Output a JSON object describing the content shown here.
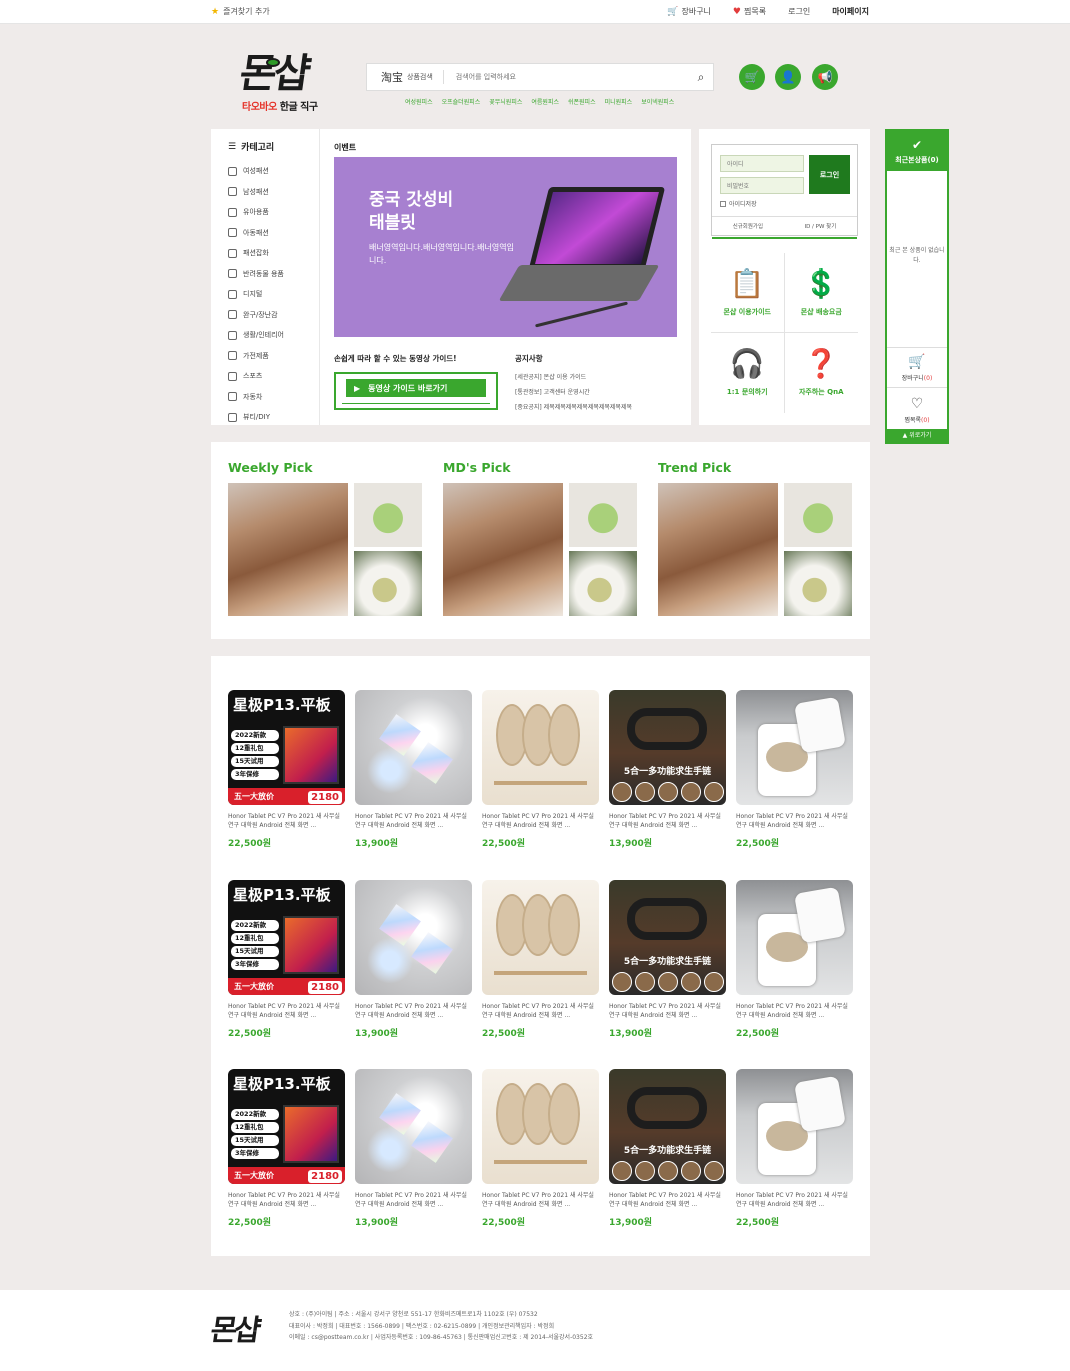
{
  "topbar": {
    "favorite": "즐겨찾기 추가",
    "cart": "장바구니",
    "wishlist": "찜목록",
    "login": "로그인",
    "mypage": "마이페이지"
  },
  "logo": {
    "main": "몬샵",
    "sub_red": "타오바오",
    "sub_black": "한글 직구"
  },
  "search": {
    "brand": "淘宝",
    "brand_label": "상품검색",
    "placeholder": "검색어를 입력하세요",
    "quick": [
      "여성원피스",
      "오프숄더원피스",
      "꽃무늬원피스",
      "여름원피스",
      "쉬폰원피스",
      "미니원피스",
      "보이넥원피스"
    ]
  },
  "categories": {
    "title": "카테고리",
    "items": [
      "여성패션",
      "남성패션",
      "유아용품",
      "아동패션",
      "패션잡화",
      "반려동물 용품",
      "디지털",
      "완구/장난감",
      "생활/인테리어",
      "가전제품",
      "스포츠",
      "자동차",
      "뷰티/DIY"
    ]
  },
  "event": {
    "label": "이벤트",
    "banner_title_1": "중국 갓성비",
    "banner_title_2": "태블릿",
    "banner_desc": "배너영역입니다.배너영역입니다.배너영역입니다.",
    "guide_title": "손쉽게 따라 할 수 있는 동영상 가이드!",
    "guide_button": "동영상 가이드 바로가기",
    "notice_title": "공지사항",
    "notices": [
      "[세관공지] 몬샵 이용 가이드",
      "[통관정보] 고객센터 운영시간",
      "[중요공지] 제목제목제목제목제목제목제목제목"
    ]
  },
  "login": {
    "id_placeholder": "아이디",
    "pw_placeholder": "비밀번호",
    "button": "로그인",
    "keep": "아이디저장",
    "signup": "신규회원가입",
    "find": "ID / PW 찾기"
  },
  "services": [
    {
      "icon": "clipboard-icon",
      "glyph": "📋",
      "label": "몬샵 이용가이드"
    },
    {
      "icon": "coin-icon",
      "glyph": "💲",
      "label": "몬샵 배송요금"
    },
    {
      "icon": "headset-icon",
      "glyph": "🎧",
      "label": "1:1 문의하기"
    },
    {
      "icon": "question-chat-icon",
      "glyph": "❓",
      "label": "자주하는 QnA"
    }
  ],
  "recent": {
    "title": "최근본상품(0)",
    "empty": "최근 본 상품이 없습니다.",
    "cart_label": "장바구니",
    "cart_count": "(0)",
    "wish_label": "찜목록",
    "wish_count": "(0)",
    "top": "위로가기"
  },
  "picks": [
    "Weekly Pick",
    "MD's Pick",
    "Trend Pick"
  ],
  "products": {
    "name": "Honor Tablet PC V7 Pro 2021 새 사무실 연구 대학원 Android 전체 화면 ...",
    "tablet": {
      "title": "星极P13.平板",
      "tags": [
        "2022新款",
        "12重礼包",
        "15天试用",
        "3年保修"
      ],
      "footer": "五一大放价",
      "price": "2180"
    },
    "bracelet_text": "5合一多功能求生手链",
    "rows": [
      [
        "22,500원",
        "13,900원",
        "22,500원",
        "13,900원",
        "22,500원"
      ],
      [
        "22,500원",
        "13,900원",
        "22,500원",
        "13,900원",
        "22,500원"
      ],
      [
        "22,500원",
        "13,900원",
        "22,500원",
        "13,900원",
        "22,500원"
      ]
    ]
  },
  "footer": {
    "line1": "상호 : (주)아이팀  |  주소 : 서울시 강서구 양천로 551-17 한화비즈메트로1차 1102호 (우) 07532",
    "line2": "대표이사 : 박정희  |  대표번호 : 1566-0899  |  팩스번호 : 02-6215-0899  |  개인정보관리책임자 : 박정희",
    "line3": "이메일 : cs@postteam.co.kr  |  사업자등록번호 : 109-86-45763  |  통신판매업신고번호 : 제 2014-서울강서-0352호"
  }
}
